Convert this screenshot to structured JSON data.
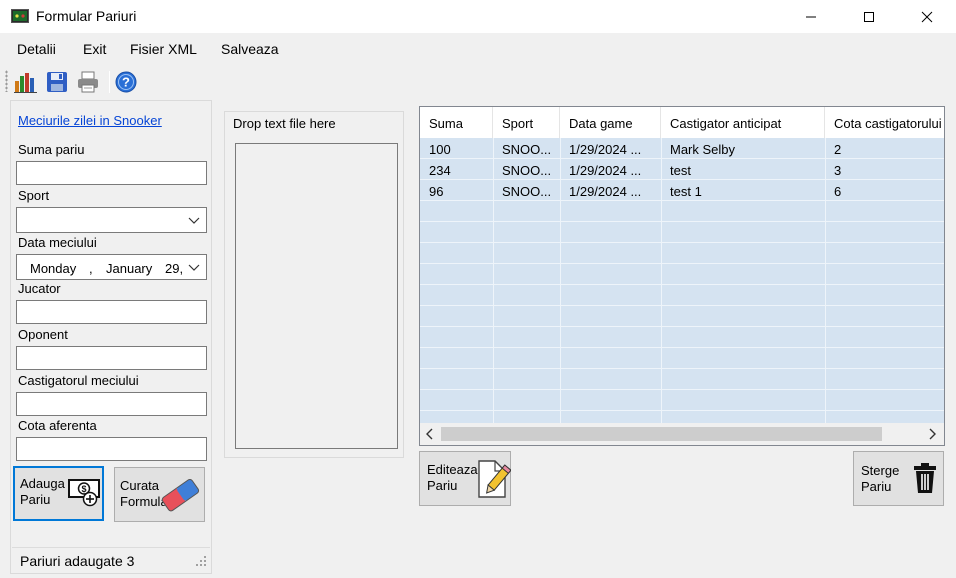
{
  "window": {
    "title": "Formular Pariuri",
    "app_icon": "app-icon",
    "controls": [
      "minimize-icon",
      "maximize-icon",
      "close-icon"
    ]
  },
  "menu": {
    "items": [
      "Detalii",
      "Exit",
      "Fisier XML",
      "Salveaza"
    ]
  },
  "toolbar": {
    "icons": [
      "chart-icon",
      "save-icon",
      "print-icon",
      "help-icon"
    ]
  },
  "form": {
    "link": "Meciurile zilei in Snooker",
    "suma_label": "Suma pariu",
    "suma_value": "",
    "sport_label": "Sport",
    "sport_value": "",
    "data_label": "Data meciului",
    "date": {
      "weekday": "Monday",
      "comma": ",",
      "month": "January",
      "day": "29,"
    },
    "jucator_label": "Jucator",
    "jucator_value": "",
    "oponent_label": "Oponent",
    "oponent_value": "",
    "castigator_label": "Castigatorul meciului",
    "castigator_value": "",
    "cota_label": "Cota aferenta",
    "cota_value": "",
    "add_button": {
      "line1": "Adauga",
      "line2": "Pariu",
      "icon": "money-add-icon"
    },
    "clear_button": {
      "line1": "Curata",
      "line2": "Formular",
      "icon": "eraser-icon"
    },
    "status": "Pariuri adaugate 3"
  },
  "drop": {
    "label": "Drop text file here"
  },
  "grid": {
    "columns": [
      "Suma",
      "Sport",
      "Data game",
      "Castigator anticipat",
      "Cota castigatorului"
    ],
    "rows": [
      [
        "100",
        "SNOO...",
        "1/29/2024 ...",
        "Mark Selby",
        "2"
      ],
      [
        "234",
        "SNOO...",
        "1/29/2024 ...",
        "test",
        "3"
      ],
      [
        "96",
        "SNOO...",
        "1/29/2024 ...",
        "test 1",
        "6"
      ]
    ],
    "empty_rows": 10,
    "row_color": "#d5e3f1"
  },
  "actions": {
    "edit_button": {
      "line1": "Editeaza",
      "line2": "Pariu",
      "icon": "pencil-icon"
    },
    "delete_button": {
      "line1": "Sterge",
      "line2": "Pariu",
      "icon": "trash-icon"
    }
  },
  "colors": {
    "accent": "#0078d7",
    "link": "#0645d6",
    "grid_selection": "#d5e3f1"
  }
}
